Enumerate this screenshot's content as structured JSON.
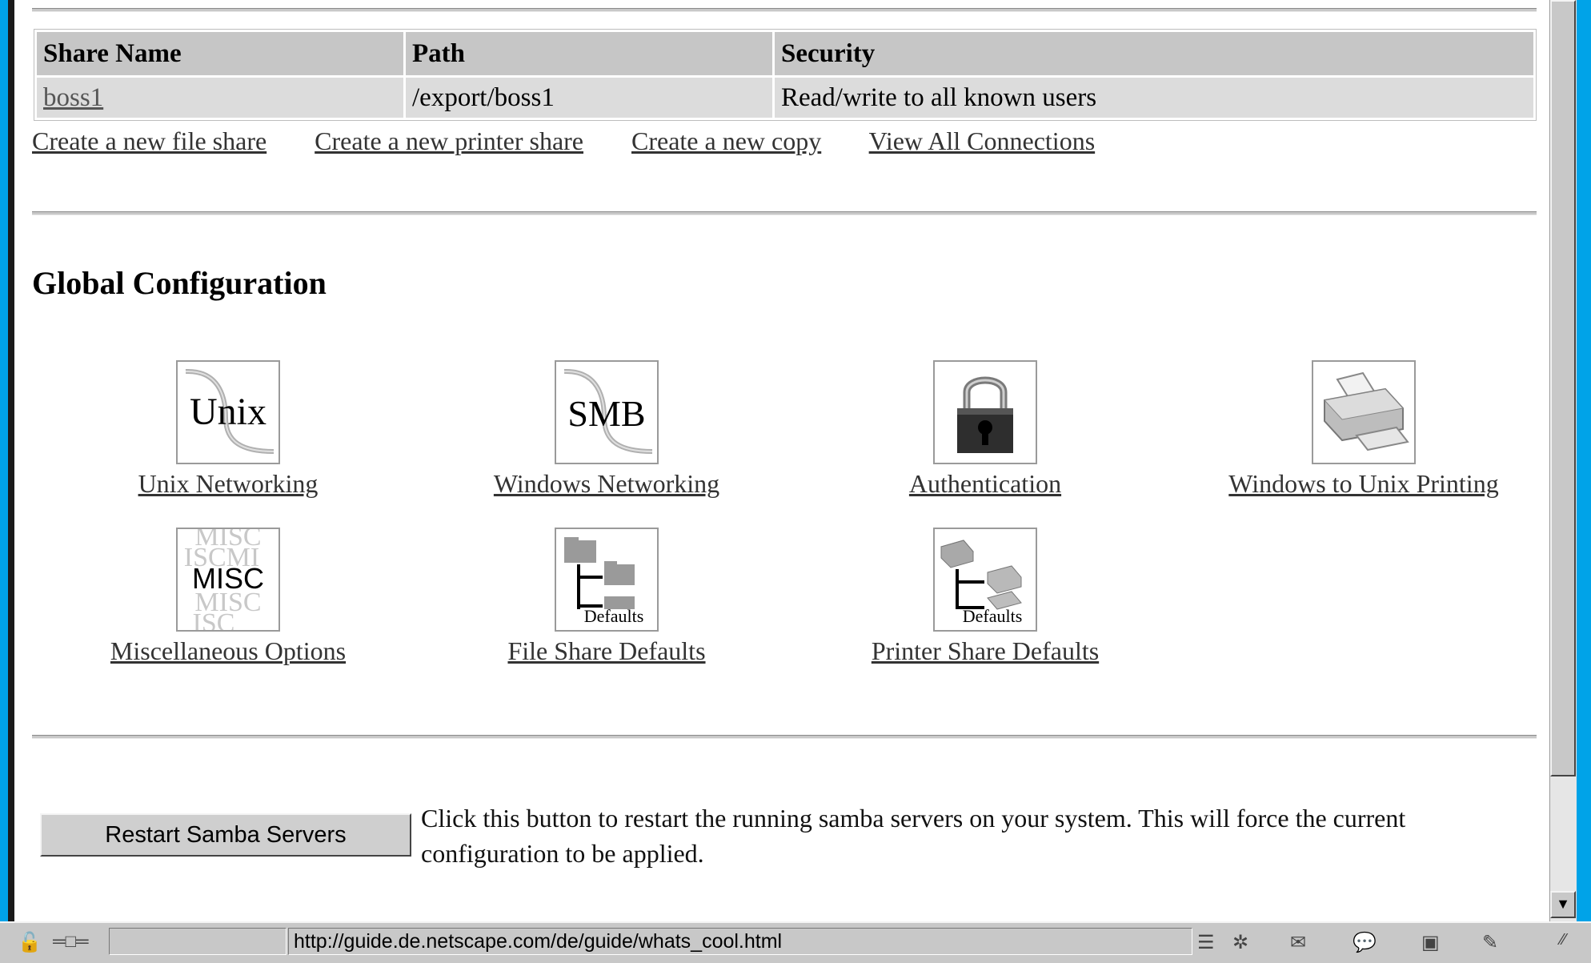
{
  "shares_table": {
    "headers": [
      "Share Name",
      "Path",
      "Security"
    ],
    "rows": [
      {
        "name": "boss1",
        "path": "/export/boss1",
        "security": "Read/write to all known users"
      }
    ]
  },
  "share_links": [
    "Create a new file share",
    "Create a new printer share",
    "Create a new copy",
    "View All Connections"
  ],
  "global_config": {
    "title": "Global Configuration",
    "items": [
      {
        "label": "Unix Networking",
        "icon": "unix-networking-icon",
        "icon_text": "Unix"
      },
      {
        "label": "Windows Networking",
        "icon": "windows-networking-icon",
        "icon_text": "SMB"
      },
      {
        "label": "Authentication",
        "icon": "padlock-icon"
      },
      {
        "label": "Windows to Unix Printing",
        "icon": "printer-icon"
      },
      {
        "label": "Miscellaneous Options",
        "icon": "misc-icon",
        "icon_text": "MISC"
      },
      {
        "label": "File Share Defaults",
        "icon": "file-share-defaults-icon",
        "icon_text": "Defaults"
      },
      {
        "label": "Printer Share Defaults",
        "icon": "printer-share-defaults-icon",
        "icon_text": "Defaults"
      }
    ]
  },
  "restart": {
    "button_label": "Restart Samba Servers",
    "description": "Click this button to restart the running samba servers on your system. This will force the current configuration to be applied."
  },
  "statusbar": {
    "url": "http://guide.de.netscape.com/de/guide/whats_cool.html"
  }
}
